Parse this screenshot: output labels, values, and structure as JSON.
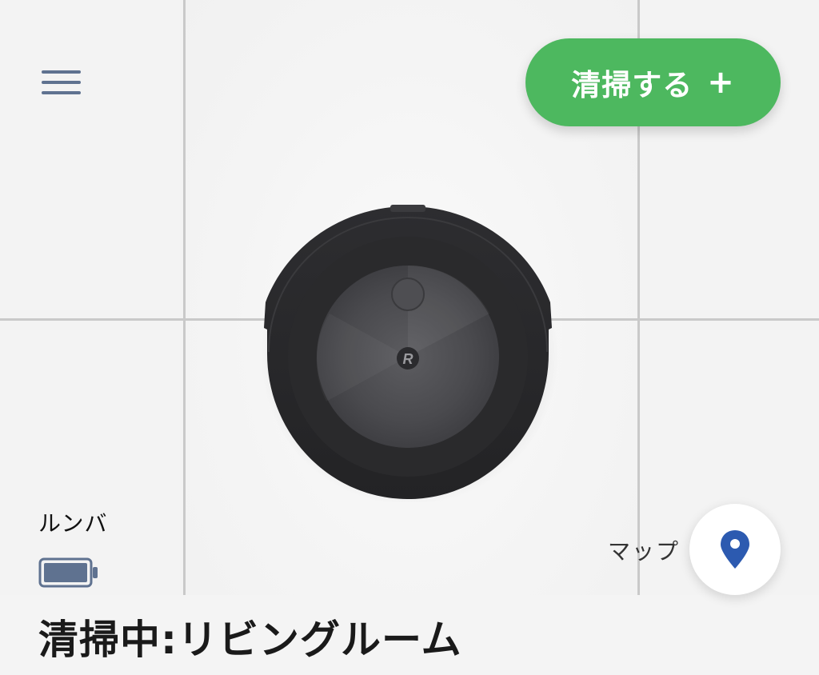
{
  "header": {
    "menu_icon": "hamburger-menu-icon",
    "clean_button": {
      "label": "清掃する",
      "plus": "+",
      "color": "#4db85f"
    }
  },
  "robot": {
    "name": "ルンバ",
    "logo_letter": "R",
    "battery_icon": "battery-icon",
    "battery_color": "#5f7290"
  },
  "status": {
    "text": "清掃中:リビングルーム"
  },
  "map": {
    "label": "マップ",
    "icon": "map-pin-icon",
    "pin_color": "#2c5ab0"
  }
}
